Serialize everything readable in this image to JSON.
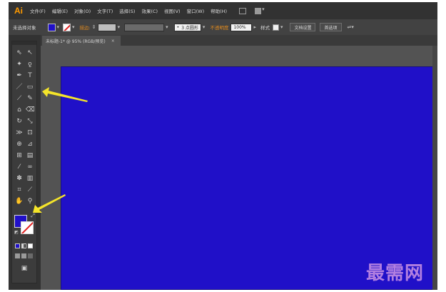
{
  "menubar": {
    "logo": "Ai",
    "items": [
      "文件(F)",
      "编辑(E)",
      "对象(O)",
      "文字(T)",
      "选择(S)",
      "效果(C)",
      "视图(V)",
      "窗口(W)",
      "帮助(H)"
    ]
  },
  "controlbar": {
    "selection_label": "未选择对象",
    "stroke_label": "描边:",
    "brush_value": "3 点圆形",
    "opacity_label": "不透明度",
    "opacity_value": "100%",
    "style_label": "样式",
    "doc_setup_label": "文档设置",
    "prefs_label": "首选项"
  },
  "document": {
    "tab_title": "未标题-1* @ 95% (RGB/预览)",
    "tab_close": "×"
  },
  "colors": {
    "artboard": "#2010c8",
    "fill": "#2010c8",
    "stroke": "#ffffff",
    "none_slash": "#e02020",
    "annotation_arrow": "#f5e52a"
  },
  "watermark": "最需网"
}
